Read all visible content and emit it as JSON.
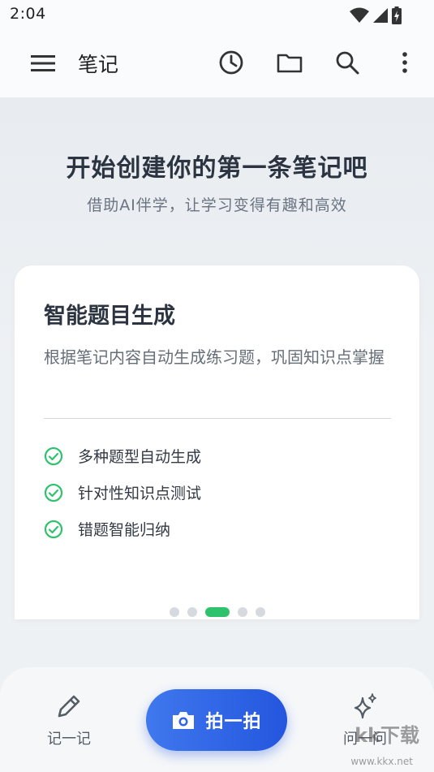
{
  "status_bar": {
    "time": "2:04"
  },
  "app_bar": {
    "title": "笔记"
  },
  "hero": {
    "title": "开始创建你的第一条笔记吧",
    "subtitle": "借助AI伴学，让学习变得有趣和高效"
  },
  "card": {
    "title": "智能题目生成",
    "description": "根据笔记内容自动生成练习题，巩固知识点掌握",
    "features": [
      "多种题型自动生成",
      "针对性知识点测试",
      "错题智能归纳"
    ],
    "page_total": 5,
    "page_active": 3
  },
  "bottom_nav": {
    "note_label": "记一记",
    "photo_label": "拍一拍",
    "ask_label": "问一问"
  },
  "watermark": {
    "brand": "kk下载",
    "url": "www.kkx.net"
  },
  "colors": {
    "accent_green": "#2fc26d",
    "primary_blue": "#2f66e6"
  }
}
